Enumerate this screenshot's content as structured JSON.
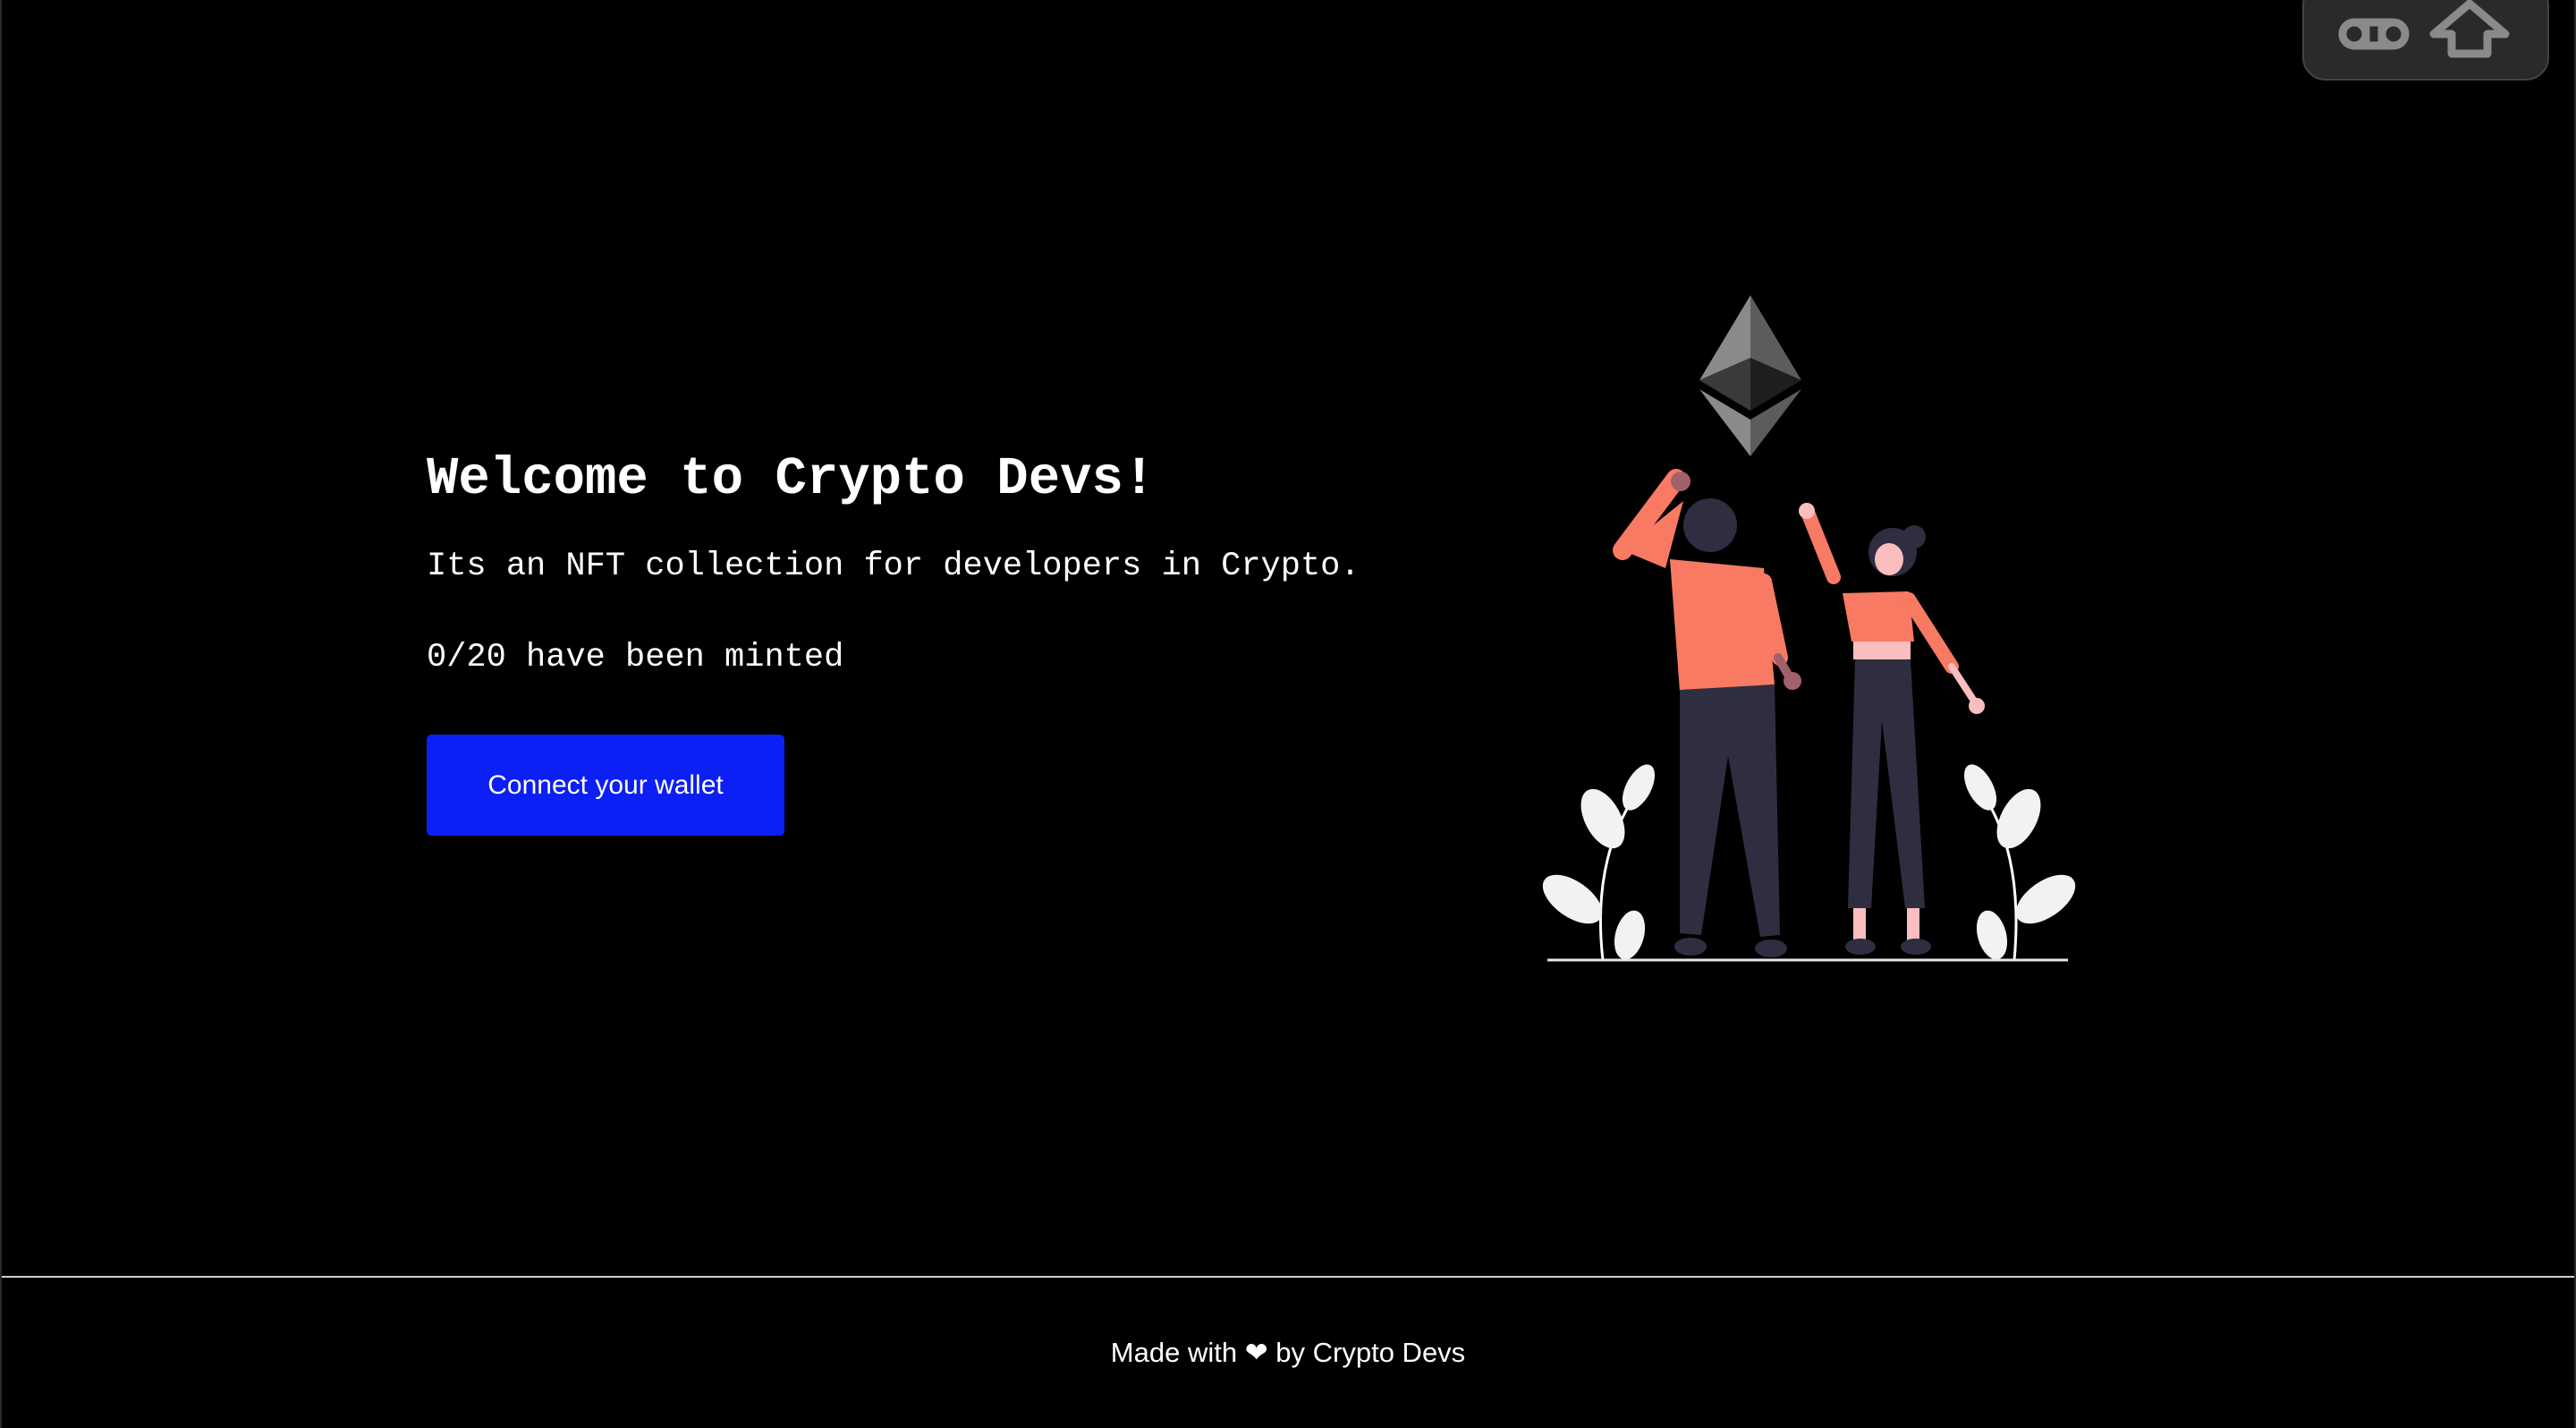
{
  "hero": {
    "title": "Welcome to Crypto Devs!",
    "description": "Its an NFT collection for developers in Crypto.",
    "minted_status": "0/20 have been minted",
    "connect_button_label": "Connect your wallet"
  },
  "illustration": {
    "icon": "ethereum-icon",
    "subject": "two people reaching toward the ethereum logo"
  },
  "footer": {
    "text": "Made with ❤ by Crypto Devs"
  },
  "overlay": {
    "icons": [
      "command-key-icon",
      "shift-key-icon"
    ]
  },
  "colors": {
    "background": "#000000",
    "text": "#ffffff",
    "button": "#0c1ff5",
    "shirt": "#f87a62",
    "pants": "#2f2e41",
    "leaves": "#f2f2f2"
  }
}
